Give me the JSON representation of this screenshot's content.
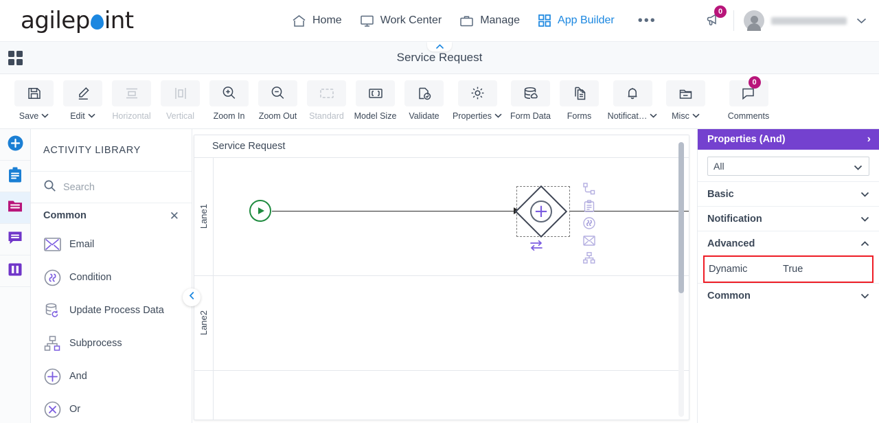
{
  "topnav": {
    "logo_pre": "agilep",
    "logo_post": "int",
    "menu": [
      {
        "label": "Home",
        "icon": "home-icon",
        "active": false
      },
      {
        "label": "Work Center",
        "icon": "monitor-icon",
        "active": false
      },
      {
        "label": "Manage",
        "icon": "briefcase-icon",
        "active": false
      },
      {
        "label": "App Builder",
        "icon": "grid-icon",
        "active": true
      }
    ],
    "overflow_label": "•••",
    "announcement_count": "0",
    "username": ""
  },
  "titlebar": {
    "title": "Service Request",
    "apps_icon": "apps-grid-icon",
    "collapse_icon": "chevron-up-icon"
  },
  "toolbar": [
    {
      "label": "Save",
      "icon": "save-icon",
      "caret": true,
      "disabled": false,
      "badge": null
    },
    {
      "label": "Edit",
      "icon": "pencil-icon",
      "caret": true,
      "disabled": false,
      "badge": null
    },
    {
      "label": "Horizontal",
      "icon": "horizontal-icon",
      "caret": false,
      "disabled": true,
      "badge": null
    },
    {
      "label": "Vertical",
      "icon": "vertical-icon",
      "caret": false,
      "disabled": true,
      "badge": null
    },
    {
      "label": "Zoom In",
      "icon": "zoom-in-icon",
      "caret": false,
      "disabled": false,
      "badge": null
    },
    {
      "label": "Zoom Out",
      "icon": "zoom-out-icon",
      "caret": false,
      "disabled": false,
      "badge": null
    },
    {
      "label": "Standard",
      "icon": "standard-icon",
      "caret": false,
      "disabled": true,
      "badge": null
    },
    {
      "label": "Model Size",
      "icon": "model-size-icon",
      "caret": false,
      "disabled": false,
      "badge": null
    },
    {
      "label": "Validate",
      "icon": "validate-icon",
      "caret": false,
      "disabled": false,
      "badge": null
    },
    {
      "label": "Properties",
      "icon": "gear-icon",
      "caret": true,
      "disabled": false,
      "badge": null
    },
    {
      "label": "Form Data",
      "icon": "database-icon",
      "caret": false,
      "disabled": false,
      "badge": null
    },
    {
      "label": "Forms",
      "icon": "forms-icon",
      "caret": false,
      "disabled": false,
      "badge": null
    },
    {
      "label": "Notificat…",
      "icon": "bell-icon",
      "caret": true,
      "disabled": false,
      "badge": null
    },
    {
      "label": "Misc",
      "icon": "folder-icon",
      "caret": true,
      "disabled": false,
      "badge": null
    },
    {
      "label": "Comments",
      "icon": "comment-icon",
      "caret": false,
      "disabled": false,
      "badge": "0"
    }
  ],
  "rail": [
    {
      "name": "add-icon",
      "active": false
    },
    {
      "name": "clipboard-icon",
      "active": false
    },
    {
      "name": "folder-icon",
      "active": true
    },
    {
      "name": "chat-icon",
      "active": false
    },
    {
      "name": "columns-icon",
      "active": false
    }
  ],
  "library": {
    "title": "ACTIVITY LIBRARY",
    "search_placeholder": "Search",
    "search_value": "",
    "group_label": "Common",
    "close_label": "✕",
    "collapse_icon": "chevron-left-icon",
    "activities": [
      {
        "label": "Email",
        "icon": "email-icon"
      },
      {
        "label": "Condition",
        "icon": "condition-icon"
      },
      {
        "label": "Update Process Data",
        "icon": "update-process-data-icon"
      },
      {
        "label": "Subprocess",
        "icon": "subprocess-icon"
      },
      {
        "label": "And",
        "icon": "and-gateway-icon"
      },
      {
        "label": "Or",
        "icon": "or-gateway-icon"
      }
    ]
  },
  "canvas": {
    "pool_label": "Service Request",
    "lanes": [
      {
        "label": "Lane1"
      },
      {
        "label": "Lane2"
      },
      {
        "label": ""
      }
    ],
    "start_event_icon": "start-event-icon",
    "gateway": {
      "type": "and-gateway",
      "symbol": "+",
      "selected": true,
      "swap_icon": "swap-icon"
    },
    "context_icons": [
      "sequence-flow-icon",
      "task-icon",
      "condition-icon",
      "email-icon",
      "subprocess-icon"
    ]
  },
  "properties": {
    "header": "Properties (And)",
    "header_arrow": "›",
    "filter_value": "All",
    "filter_options": [
      "All"
    ],
    "sections": [
      {
        "label": "Basic",
        "expanded": false
      },
      {
        "label": "Notification",
        "expanded": false
      },
      {
        "label": "Advanced",
        "expanded": true
      },
      {
        "label": "Common",
        "expanded": false
      }
    ],
    "advanced_rows": [
      {
        "key": "Dynamic",
        "value": "True",
        "highlighted": true
      }
    ]
  },
  "colors": {
    "brand_blue": "#1b87e0",
    "accent_purple": "#7441cf",
    "badge_magenta": "#b8157a",
    "highlight_red": "#ee1c25",
    "start_green": "#1f8b3f",
    "gateway_purple": "#7b5ce0"
  }
}
